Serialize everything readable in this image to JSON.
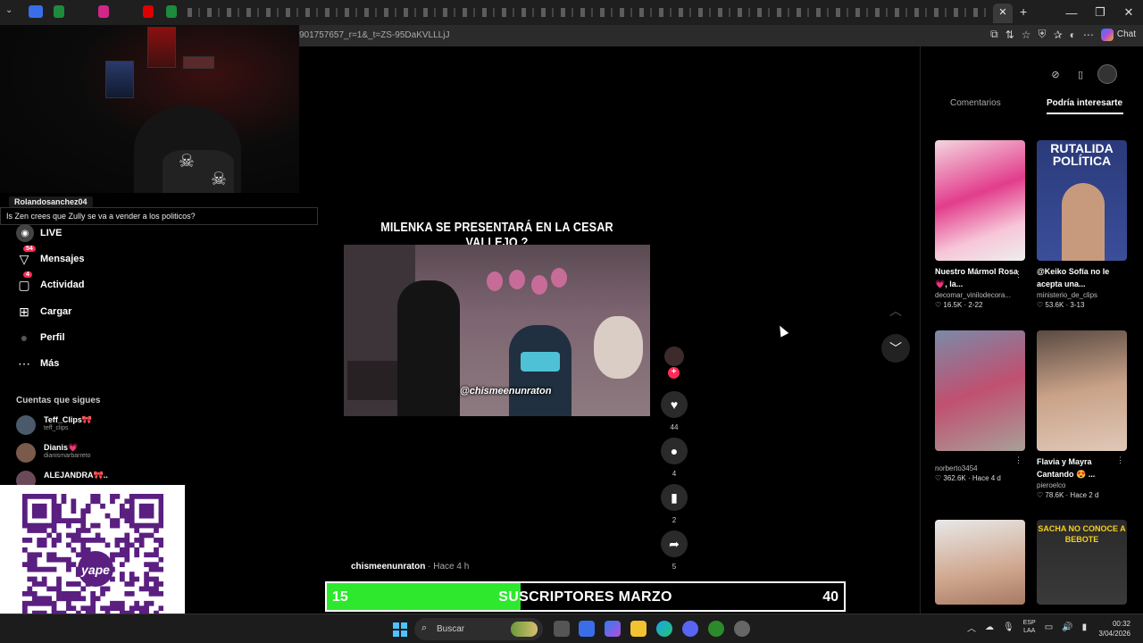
{
  "browser": {
    "url": "901757657_r=1&_t=ZS-95DaKVLLLjJ",
    "chat_label": "Chat",
    "tabs_count_hint": "many",
    "window_controls": [
      "—",
      "❐",
      "✕"
    ],
    "addr_icons": [
      "⧉",
      "⇅",
      "☆",
      "⛨",
      "✰",
      "◐",
      "⋯"
    ]
  },
  "stream_chat": {
    "username": "Rolandosanchez04",
    "message": "Is Zen crees que Zully se va a vender a los politicos?"
  },
  "nav": {
    "items": [
      {
        "label": "LIVE",
        "icon": "live-icon",
        "glyph": "◉"
      },
      {
        "label": "Mensajes",
        "icon": "messages-icon",
        "glyph": "▽",
        "badge": "54"
      },
      {
        "label": "Actividad",
        "icon": "activity-icon",
        "glyph": "▢",
        "badge": "4"
      },
      {
        "label": "Cargar",
        "icon": "upload-icon",
        "glyph": "⊞"
      },
      {
        "label": "Perfil",
        "icon": "profile-icon",
        "glyph": "●"
      },
      {
        "label": "Más",
        "icon": "more-icon",
        "glyph": "⋯"
      }
    ],
    "following_title": "Cuentas que sigues",
    "following": [
      {
        "name": "Teff_Clips🎀",
        "handle": "teff_clips"
      },
      {
        "name": "Dianis💗",
        "handle": "dianismarbarreto"
      },
      {
        "name": "ALEJANDRA🎀..",
        "handle": ""
      }
    ]
  },
  "video": {
    "title": "MILENKA SE PRESENTARÁ EN LA CESAR VALLEJO ?",
    "watermark": "@chismeenunraton",
    "author": "chismeenunraton",
    "time": " · Hace 4 h",
    "likes": "44",
    "comments": "4",
    "saves": "2",
    "shares": "5"
  },
  "goal": {
    "current": "15",
    "label": "SUSCRIPTORES MARZO",
    "max": "40",
    "progress": 0.375,
    "fill_color": "#2ee82e"
  },
  "right_panel": {
    "tab_comments": "Comentarios",
    "tab_interest": "Podría interesarte",
    "cards": [
      {
        "title": "Nuestro Mármol Rosa 💗, la...",
        "author": "decomar_vinilodecora...",
        "stats": "♡ 16.5K · 2-22",
        "more": "⋮"
      },
      {
        "title": "@Keiko Sofía no le acepta una...",
        "author": "ministerio_de_clips",
        "stats": "♡ 53.6K · 3-13",
        "overlay": "RUTALIDA POLÍTICA"
      },
      {
        "title": "",
        "author": "norberto3454",
        "stats": "♡ 362.6K · Hace 4 d",
        "more": "⋮"
      },
      {
        "title": "Flavia y Mayra Cantando 😍 ...",
        "author": "pieroelco",
        "stats": "♡ 78.6K · Hace 2 d",
        "more": "⋮"
      },
      {
        "title": "",
        "author": "",
        "stats": ""
      },
      {
        "title": "",
        "author": "",
        "stats": "",
        "overlay": "SACHA NO CONOCE A BEBOTE"
      }
    ]
  },
  "taskbar": {
    "search_label": "Buscar",
    "lang_top": "ESP",
    "lang_bottom": "LAA",
    "time": "00:32",
    "date": "3/04/2026"
  },
  "qr": {
    "brand": "yape",
    "fg_color": "#5a1f80"
  }
}
